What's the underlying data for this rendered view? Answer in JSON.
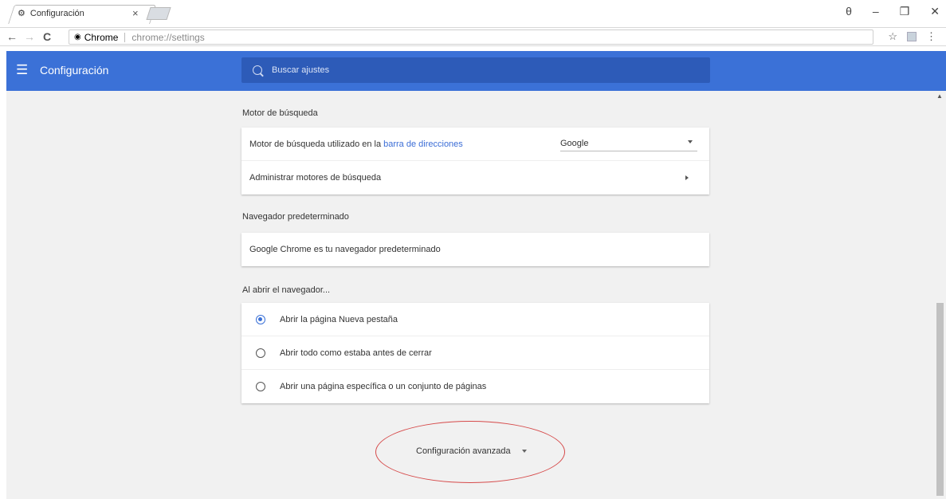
{
  "tab": {
    "title": "Configuración",
    "close": "×"
  },
  "window": {
    "user": "θ",
    "minimize": "–",
    "restore": "❐",
    "close": "✕"
  },
  "toolbar": {
    "back": "←",
    "forward": "→",
    "reload": "C",
    "site_label": "Chrome",
    "url": "chrome://settings",
    "star": "☆",
    "menu": "⋮"
  },
  "header": {
    "title": "Configuración",
    "search_placeholder": "Buscar ajustes"
  },
  "search_engine": {
    "section_title": "Motor de búsqueda",
    "row1_text": "Motor de búsqueda utilizado en la ",
    "row1_link": "barra de direcciones",
    "row1_value": "Google",
    "row2_text": "Administrar motores de búsqueda"
  },
  "default_browser": {
    "section_title": "Navegador predeterminado",
    "row_text": "Google Chrome es tu navegador predeterminado"
  },
  "on_startup": {
    "section_title": "Al abrir el navegador...",
    "options": [
      {
        "label": "Abrir la página Nueva pestaña",
        "checked": true
      },
      {
        "label": "Abrir todo como estaba antes de cerrar",
        "checked": false
      },
      {
        "label": "Abrir una página específica o un conjunto de páginas",
        "checked": false
      }
    ]
  },
  "advanced": {
    "label": "Configuración avanzada"
  },
  "colors": {
    "header": "#3b71d7",
    "search": "#2d5bb8",
    "annotation": "#d64a4a"
  }
}
